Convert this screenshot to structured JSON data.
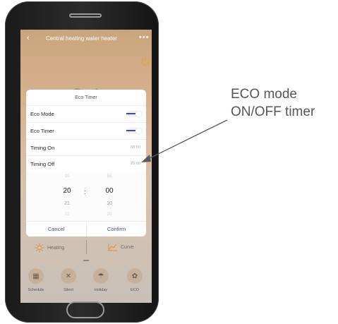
{
  "header": {
    "back_icon": "chevron-left-icon",
    "title": "Central heating water heater",
    "more_icon": "more-dots-icon",
    "power_icon": "power-icon"
  },
  "background": {
    "temperature_text": "24"
  },
  "dialog": {
    "title": "Eco Timer",
    "rows": [
      {
        "label": "Eco Mode",
        "type": "toggle",
        "on": true
      },
      {
        "label": "Eco Timer",
        "type": "toggle",
        "on": true
      },
      {
        "label": "Timing On",
        "type": "value",
        "value": "08:00"
      },
      {
        "label": "Timing Off",
        "type": "value",
        "value": "20:00"
      }
    ],
    "picker": {
      "hours": {
        "above_dim": "19",
        "selected": "20",
        "below": "21",
        "below_dim": "22"
      },
      "separator": ":",
      "minutes": {
        "above_dim": "55",
        "selected": "00",
        "below": "10",
        "below_dim": "20"
      }
    },
    "cancel_label": "Cancel",
    "confirm_label": "Confirm"
  },
  "modes": [
    {
      "label": "Heating",
      "icon": "sun-icon"
    },
    {
      "label": "Curve",
      "icon": "curve-chart-icon"
    }
  ],
  "tabs": [
    {
      "label": "Schedule",
      "icon": "calendar-icon"
    },
    {
      "label": "Silent",
      "icon": "mute-icon"
    },
    {
      "label": "Holiday",
      "icon": "umbrella-icon"
    },
    {
      "label": "ECO",
      "icon": "eco-leaf-icon"
    }
  ],
  "callout": {
    "line1": "ECO mode",
    "line2": "ON/OFF timer"
  },
  "colors": {
    "accent": "#3a4fa0",
    "screen_bg": "#d7b18c",
    "phone_body": "#1a1a1a",
    "arrow": "#555555"
  }
}
